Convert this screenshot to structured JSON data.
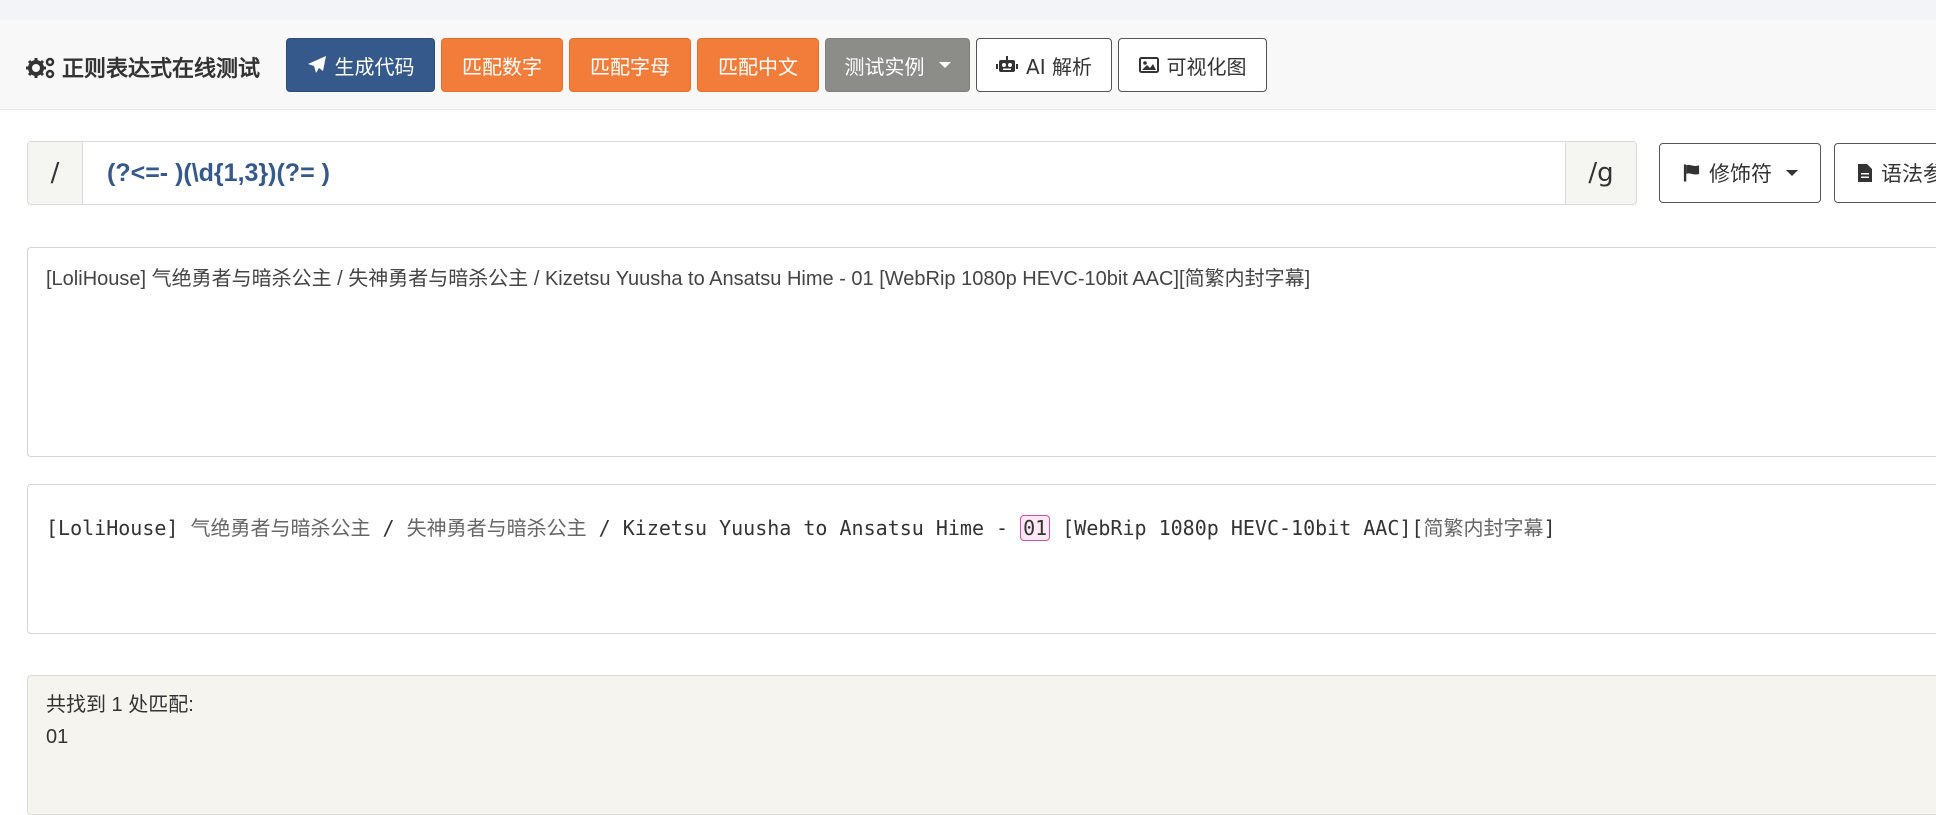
{
  "brand": {
    "title": "正则表达式在线测试"
  },
  "toolbar": {
    "generate_code": "生成代码",
    "match_digits": "匹配数字",
    "match_letters": "匹配字母",
    "match_chinese": "匹配中文",
    "test_examples": "测试实例",
    "ai_analysis": "AI 解析",
    "visualize": "可视化图"
  },
  "regex": {
    "prefix": "/",
    "pattern": "(?<=- )(\\d{1,3})(?= )",
    "suffix": "/g",
    "modifiers_label": "修饰符",
    "syntax_ref_label": "语法参"
  },
  "test_text": "[LoliHouse] 气绝勇者与暗杀公主 / 失神勇者与暗杀公主 / Kizetsu Yuusha to Ansatsu Hime - 01 [WebRip 1080p HEVC-10bit AAC][简繁内封字幕]",
  "highlight": {
    "seg1": "[LoliHouse] ",
    "seg2": "气绝勇者与暗杀公主",
    "seg3": " / ",
    "seg4": "失神勇者与暗杀公主",
    "seg5": " / Kizetsu Yuusha to Ansatsu Hime - ",
    "match": "01",
    "seg6": " [WebRip 1080p HEVC-10bit AAC][",
    "seg7": "简繁内封字幕",
    "seg8": "]"
  },
  "result": {
    "summary": "共找到 1 处匹配:",
    "matches": [
      "01"
    ]
  },
  "colors": {
    "primary": "#34598a",
    "orange": "#f27d3b",
    "gray": "#8c8c88",
    "match_border": "#d9509f",
    "match_fill": "#fde8f6"
  }
}
